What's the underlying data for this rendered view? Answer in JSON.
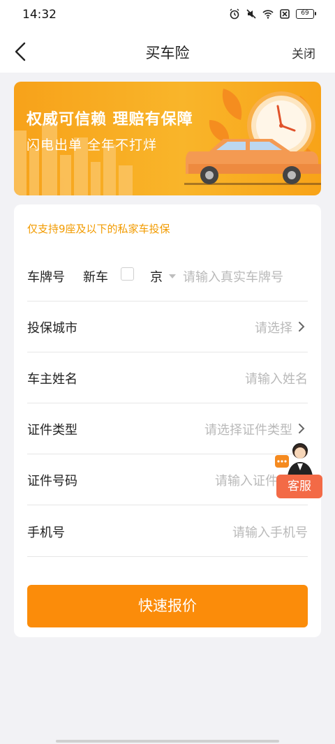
{
  "status_bar": {
    "time": "14:32",
    "battery": "69"
  },
  "nav": {
    "title": "买车险",
    "close_label": "关闭"
  },
  "banner": {
    "title": "权威可信赖  理赔有保障",
    "subtitle": "闪电出单  全年不打烊"
  },
  "form": {
    "notice": "仅支持9座及以下的私家车投保",
    "plate": {
      "label": "车牌号",
      "new_car_label": "新车",
      "province": "京",
      "placeholder": "请输入真实车牌号"
    },
    "city": {
      "label": "投保城市",
      "placeholder": "请选择"
    },
    "owner_name": {
      "label": "车主姓名",
      "placeholder": "请输入姓名"
    },
    "id_type": {
      "label": "证件类型",
      "placeholder": "请选择证件类型"
    },
    "id_number": {
      "label": "证件号码",
      "placeholder": "请输入证件"
    },
    "phone": {
      "label": "手机号",
      "placeholder": "请输入手机号"
    },
    "submit_label": "快速报价"
  },
  "customer_service": {
    "label": "客服"
  },
  "colors": {
    "accent": "#fb8c0a",
    "notice": "#f29b00",
    "service": "#f36a46"
  }
}
